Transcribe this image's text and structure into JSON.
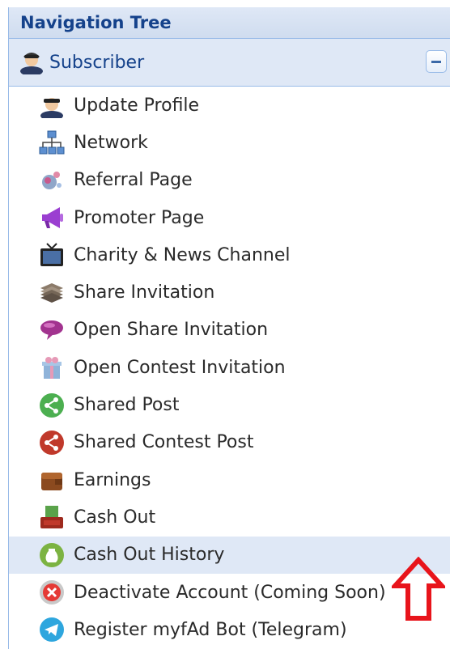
{
  "panel": {
    "title": "Navigation Tree"
  },
  "group": {
    "label": "Subscriber",
    "icon": "person-icon",
    "collapse_glyph": "−"
  },
  "items": [
    {
      "label": "Update Profile",
      "icon": "person-icon"
    },
    {
      "label": "Network",
      "icon": "network-icon"
    },
    {
      "label": "Referral Page",
      "icon": "referral-icon"
    },
    {
      "label": "Promoter Page",
      "icon": "megaphone-icon"
    },
    {
      "label": "Charity & News Channel",
      "icon": "tv-icon"
    },
    {
      "label": "Share Invitation",
      "icon": "invitation-icon"
    },
    {
      "label": "Open Share Invitation",
      "icon": "speech-bubble-icon"
    },
    {
      "label": "Open Contest Invitation",
      "icon": "gift-icon"
    },
    {
      "label": "Shared Post",
      "icon": "share-green-icon"
    },
    {
      "label": "Shared Contest Post",
      "icon": "share-red-icon"
    },
    {
      "label": "Earnings",
      "icon": "wallet-icon"
    },
    {
      "label": "Cash Out",
      "icon": "cash-icon"
    },
    {
      "label": "Cash Out History",
      "icon": "money-bag-icon",
      "selected": true
    },
    {
      "label": "Deactivate Account (Coming Soon)",
      "icon": "deactivate-icon"
    },
    {
      "label": "Register myfAd Bot (Telegram)",
      "icon": "telegram-icon"
    }
  ],
  "annotation": {
    "icon": "up-arrow-icon",
    "color": "#e8141b"
  },
  "colors": {
    "header_text": "#15428b",
    "border": "#99bbe8",
    "selected_bg": "#dfe8f6"
  }
}
